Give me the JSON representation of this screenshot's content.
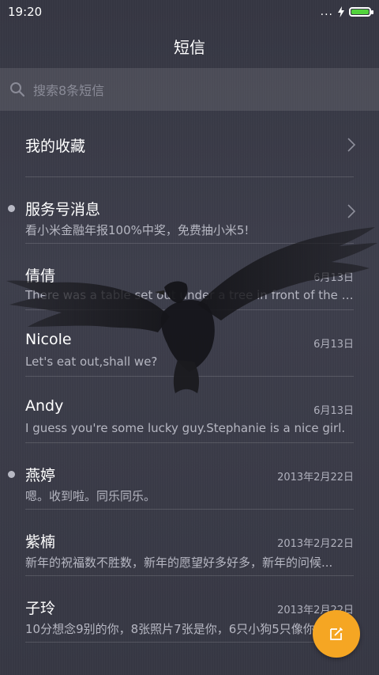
{
  "status_bar": {
    "time": "19:20",
    "dots": "...",
    "battery_level": 1.0,
    "battery_color": "#52d23c"
  },
  "header": {
    "title": "短信"
  },
  "search": {
    "placeholder": "搜索8条短信"
  },
  "favorites": {
    "label": "我的收藏"
  },
  "conversations": [
    {
      "name": "服务号消息",
      "preview": "看小米金融年报100%中奖，免费抽小米5!",
      "date": "",
      "unread": true,
      "chevron": true
    },
    {
      "name": "倩倩",
      "preview": "There was a table set out under a tree in front of the ho...",
      "date": "6月13日",
      "unread": false,
      "chevron": false
    },
    {
      "name": "Nicole",
      "preview": "Let's eat out,shall we?",
      "date": "6月13日",
      "unread": false,
      "chevron": false
    },
    {
      "name": "Andy",
      "preview": "I guess you're some lucky guy.Stephanie is a nice girl.",
      "date": "6月13日",
      "unread": false,
      "chevron": false
    },
    {
      "name": "燕婷",
      "preview": "嗯。收到啦。同乐同乐。",
      "date": "2013年2月22日",
      "unread": true,
      "chevron": false
    },
    {
      "name": "紫楠",
      "preview": "新年的祝福数不胜数，新年的愿望好多好多，新年的问候...",
      "date": "2013年2月22日",
      "unread": false,
      "chevron": false
    },
    {
      "name": "子玲",
      "preview": "10分想念9别的你，8张照片7张是你，6只小狗5只像你...",
      "date": "2013年2月22日",
      "unread": false,
      "chevron": false
    }
  ],
  "fab": {
    "icon": "compose-icon",
    "color": "#f5a623"
  },
  "decorations": {
    "background_image": "crow-icon"
  }
}
